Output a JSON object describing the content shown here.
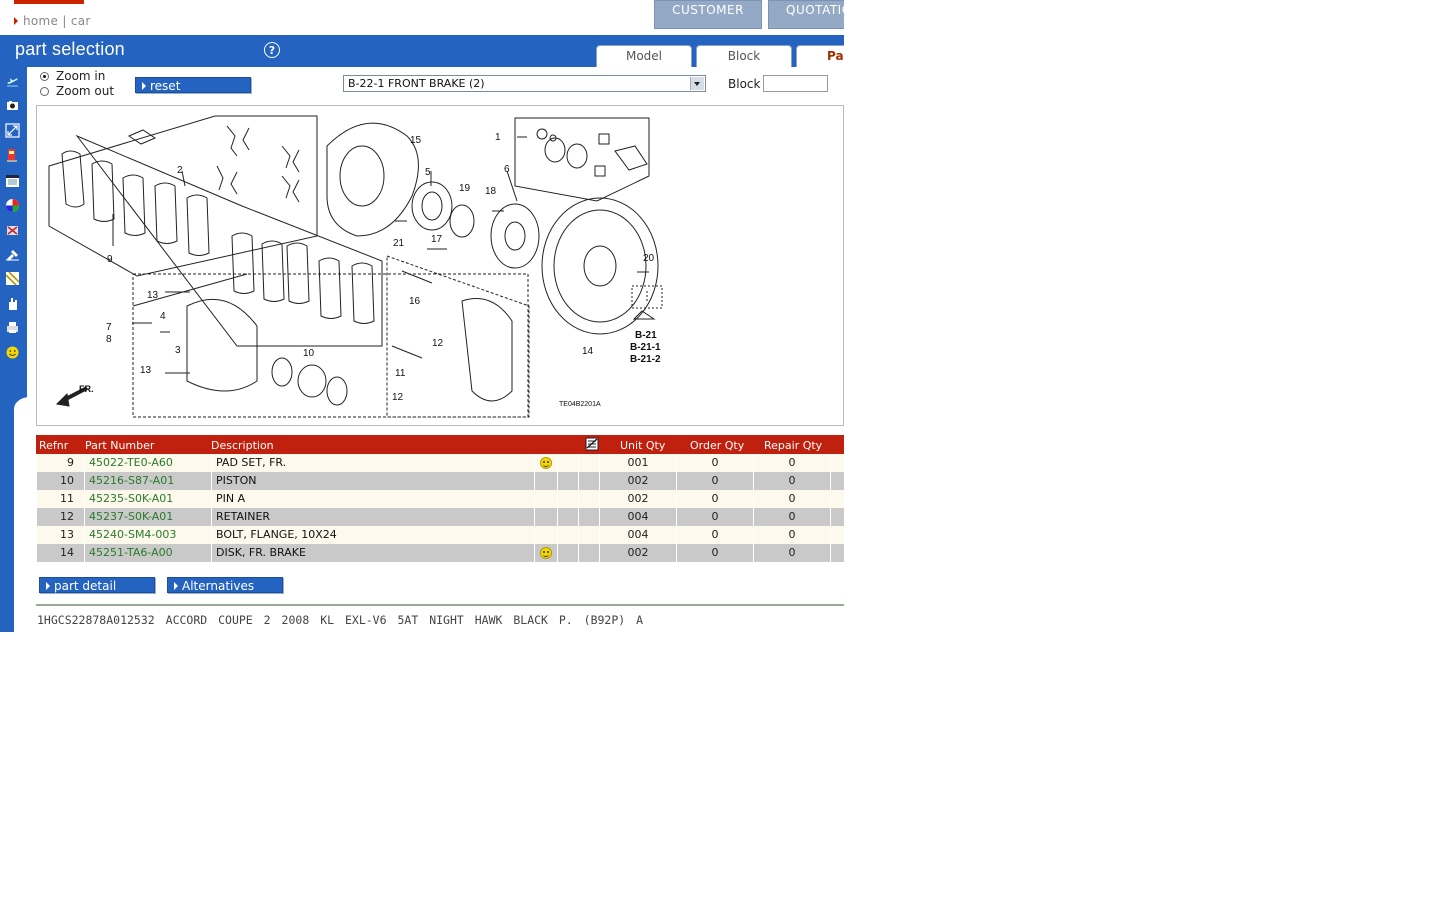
{
  "breadcrumb": {
    "home": "home",
    "separator": "|",
    "current": "car"
  },
  "top_buttons": [
    {
      "label": "CUSTOMER"
    },
    {
      "label": "QUOTATIC"
    }
  ],
  "header": {
    "title": "part selection",
    "help": "?"
  },
  "tabs": [
    {
      "label": "Model"
    },
    {
      "label": "Block"
    },
    {
      "label": "Pa"
    }
  ],
  "zoom": {
    "zoom_in": "Zoom in",
    "zoom_out": "Zoom out",
    "selected": "Zoom in"
  },
  "reset_label": "reset",
  "block_select": {
    "value": "B-22-1 FRONT BRAKE (2)"
  },
  "block_field": {
    "label": "Block",
    "value": ""
  },
  "diagram": {
    "callouts": [
      "15",
      "1",
      "5",
      "6",
      "19",
      "18",
      "2",
      "21",
      "17",
      "20",
      "9",
      "16",
      "13",
      "4",
      "7",
      "8",
      "3",
      "10",
      "12",
      "11",
      "13",
      "12",
      "14"
    ],
    "refs": [
      "B-21",
      "B-21-1",
      "B-21-2"
    ],
    "code": "TE04B2201A",
    "fr_label": "FR."
  },
  "table": {
    "headers": {
      "ref": "Refnr",
      "part_number": "Part Number",
      "description": "Description",
      "unit_qty": "Unit Qty",
      "order_qty": "Order Qty",
      "repair_qty": "Repair Qty"
    },
    "rows": [
      {
        "ref": "9",
        "part_number": "45022-TE0-A60",
        "description": "PAD SET, FR.",
        "smiley": true,
        "unit_qty": "001",
        "order_qty": "0",
        "repair_qty": "0"
      },
      {
        "ref": "10",
        "part_number": "45216-S87-A01",
        "description": "PISTON",
        "smiley": false,
        "unit_qty": "002",
        "order_qty": "0",
        "repair_qty": "0"
      },
      {
        "ref": "11",
        "part_number": "45235-S0K-A01",
        "description": "PIN A",
        "smiley": false,
        "unit_qty": "002",
        "order_qty": "0",
        "repair_qty": "0"
      },
      {
        "ref": "12",
        "part_number": "45237-S0K-A01",
        "description": "RETAINER",
        "smiley": false,
        "unit_qty": "004",
        "order_qty": "0",
        "repair_qty": "0"
      },
      {
        "ref": "13",
        "part_number": "45240-SM4-003",
        "description": "BOLT, FLANGE, 10X24",
        "smiley": false,
        "unit_qty": "004",
        "order_qty": "0",
        "repair_qty": "0"
      },
      {
        "ref": "14",
        "part_number": "45251-TA6-A00",
        "description": "DISK, FR. BRAKE",
        "smiley": true,
        "unit_qty": "002",
        "order_qty": "0",
        "repair_qty": "0"
      }
    ]
  },
  "actions": {
    "part_detail": "part detail",
    "alternatives": "Alternatives"
  },
  "vehicle": {
    "vin": "1HGCS22878A012532",
    "model": "ACCORD COUPE",
    "doors": "2",
    "year": "2008",
    "area": "KL",
    "grade": "EXL-V6",
    "trans": "5AT",
    "color": "NIGHT HAWK BLACK P. (B92P)",
    "code": "A"
  },
  "colors": {
    "brand_blue": "#2563c0",
    "header_red": "#c0200e",
    "part_green": "#2a7a2a"
  }
}
